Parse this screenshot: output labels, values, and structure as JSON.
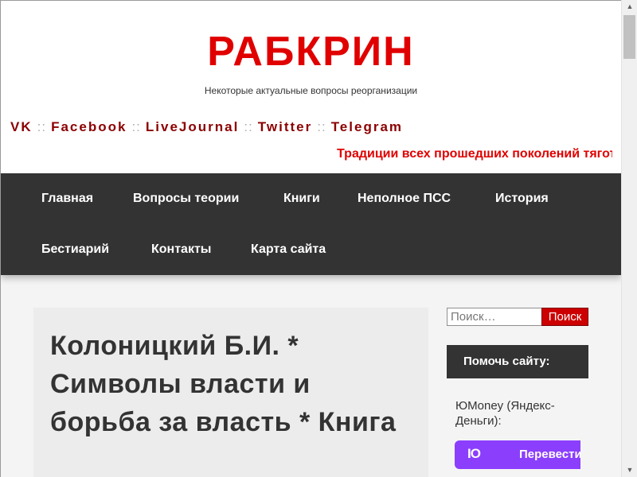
{
  "site": {
    "title": "РАБКРИН",
    "tagline": "Некоторые актуальные вопросы реорганизации",
    "marquee": "Традиции всех прошедших поколений тяготеют"
  },
  "social": {
    "separator": "::",
    "links": [
      "VK",
      "Facebook",
      "LiveJournal",
      "Twitter",
      "Telegram"
    ]
  },
  "nav": {
    "items": [
      "Главная",
      "Вопросы теории",
      "Книги",
      "Неполное ПСС",
      "История",
      "Бестиарий",
      "Контакты",
      "Карта сайта"
    ]
  },
  "post": {
    "title": "Колоницкий Б.И. * Символы власти и борьба за власть * Книга"
  },
  "sidebar": {
    "search_placeholder": "Поиск…",
    "search_button": "Поиск",
    "widget_title": "Помочь сайту:",
    "yoomoney_text": "ЮMoney (Яндекс-Деньги):",
    "yoomoney_logo": "IO",
    "yoomoney_button": "Перевести"
  },
  "colors": {
    "title_red": "#e00000",
    "link_dark_red": "#8b0000",
    "nav_bg": "#333333",
    "button_red": "#cc0000",
    "yoomoney_purple": "#8b3ffd"
  },
  "icons": {
    "scroll_up": "triangle-up",
    "scroll_down": "triangle-down"
  }
}
